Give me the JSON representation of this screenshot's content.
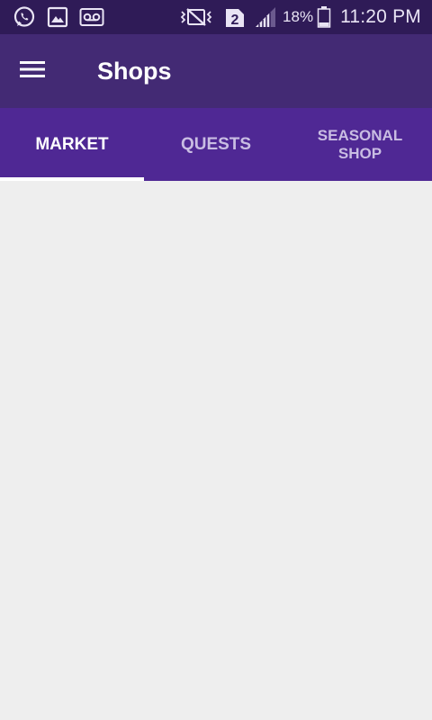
{
  "status_bar": {
    "left_icons": [
      "whatsapp-icon",
      "gallery-icon",
      "voicemail-icon"
    ],
    "right_icons": [
      "vibrate-mute-icon",
      "sim2-icon",
      "signal-icon",
      "battery-icon"
    ],
    "sim_label": "2",
    "battery_percent": "18%",
    "time": "11:20 PM"
  },
  "app_bar": {
    "menu_icon": "hamburger-menu-icon",
    "title": "Shops"
  },
  "tabs": [
    {
      "label": "MARKET",
      "active": true
    },
    {
      "label": "QUESTS",
      "active": false
    },
    {
      "label": "SEASONAL SHOP",
      "active": false
    }
  ],
  "colors": {
    "status_bar": "#2f1b57",
    "app_bar": "#432a74",
    "tab_bar": "#4f2894",
    "content_bg": "#eeeeee",
    "active_tab_text": "#ffffff",
    "inactive_tab_text": "#c9bde3"
  }
}
